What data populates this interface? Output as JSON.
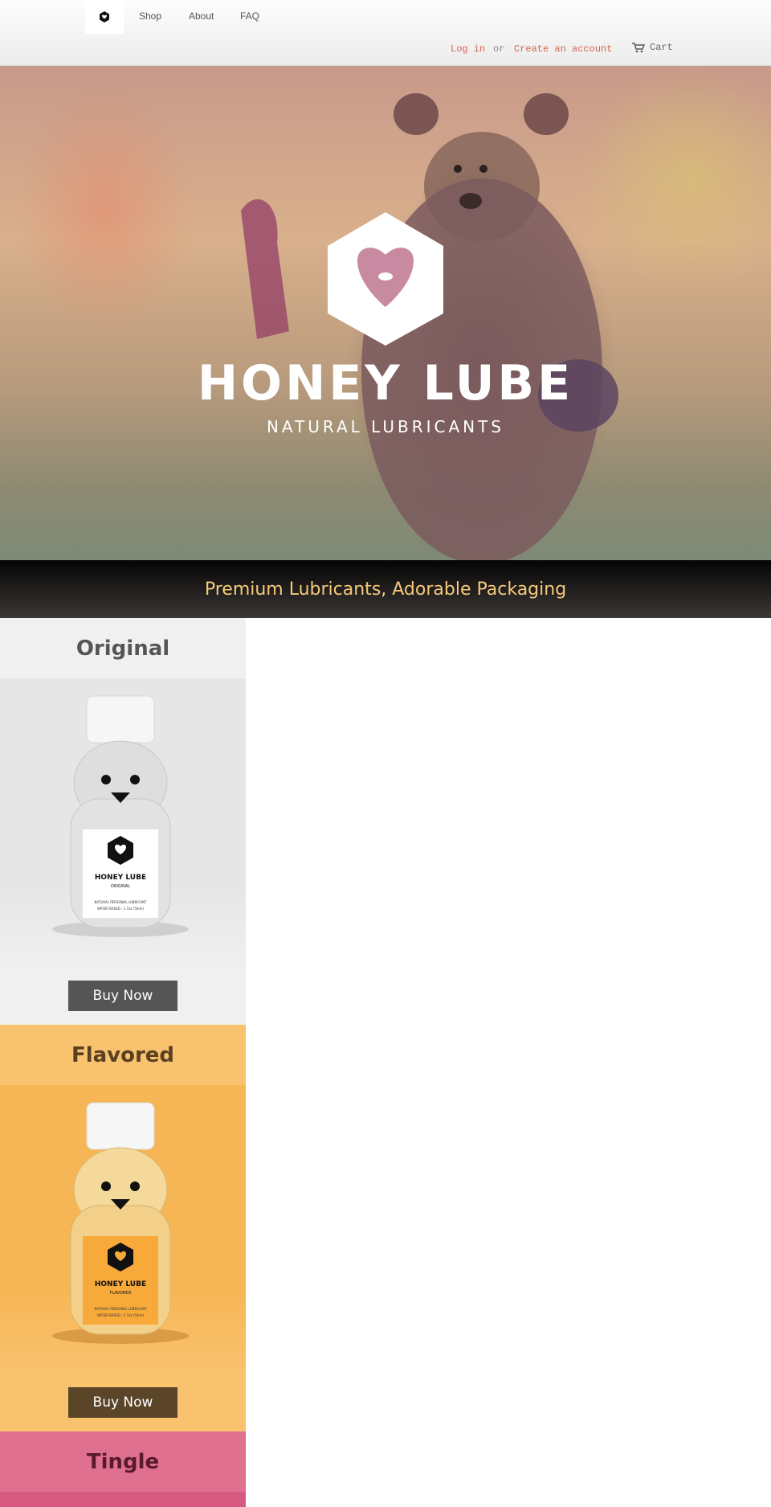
{
  "header": {
    "nav": [
      "Shop",
      "About",
      "FAQ"
    ],
    "login": "Log in",
    "or": "or",
    "create_account": "Create an account",
    "cart": "Cart"
  },
  "hero": {
    "title": "HONEY LUBE",
    "subtitle": "NATURAL LUBRICANTS"
  },
  "tagline": "Premium Lubricants, Adorable Packaging",
  "products": [
    {
      "name": "Original",
      "label_brand": "HONEY LUBE",
      "label_variant": "ORIGINAL",
      "label_fine1": "NATURAL PERSONAL LUBRICANT",
      "label_fine2": "WATER BASED · 1.7oz (50ml)",
      "button": "Buy Now"
    },
    {
      "name": "Flavored",
      "label_brand": "HONEY LUBE",
      "label_variant": "FLAVORED",
      "label_fine1": "NATURAL PERSONAL LUBRICANT",
      "label_fine2": "WATER BASED · 1.7oz (50ml)",
      "button": "Buy Now"
    },
    {
      "name": "Tingle"
    }
  ],
  "colors": {
    "accent_link": "#d4634e",
    "tagline_text": "#f6c97a",
    "original_head_bg": "#f0f0f0",
    "original_body_bg": "#e6e6e6",
    "flavored_head_bg": "#f9c26f",
    "flavored_body_bg": "#f7b655",
    "tingle_head_bg": "#e07090"
  }
}
